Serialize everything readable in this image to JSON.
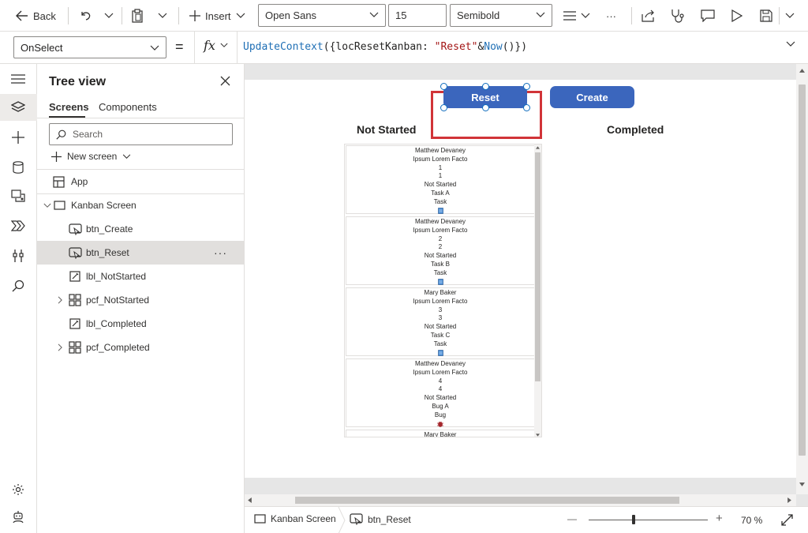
{
  "toolbar": {
    "back_label": "Back",
    "insert_label": "Insert",
    "font_family": "Open Sans",
    "font_size": "15",
    "font_weight": "Semibold",
    "more_label": "···"
  },
  "formula": {
    "property": "OnSelect",
    "equals": "=",
    "fx": "fx",
    "code_fn1": "UpdateContext",
    "code_part1": "({locResetKanban: ",
    "code_str": "\"Reset\"",
    "code_amp": "&",
    "code_fn2": "Now",
    "code_end": "()})"
  },
  "tree": {
    "title": "Tree view",
    "tabs": [
      "Screens",
      "Components"
    ],
    "search_placeholder": "Search",
    "new_screen_label": "New screen",
    "nodes": [
      {
        "label": "App"
      },
      {
        "label": "Kanban Screen"
      },
      {
        "label": "btn_Create"
      },
      {
        "label": "btn_Reset",
        "more": "···"
      },
      {
        "label": "lbl_NotStarted"
      },
      {
        "label": "pcf_NotStarted"
      },
      {
        "label": "lbl_Completed"
      },
      {
        "label": "pcf_Completed"
      }
    ]
  },
  "canvas": {
    "reset_label": "Reset",
    "create_label": "Create",
    "not_started_label": "Not Started",
    "completed_label": "Completed",
    "cards": [
      {
        "lines": [
          "Matthew Devaney",
          "Ipsum Lorem Facto",
          "1",
          "1",
          "Not Started",
          "Task A",
          "Task"
        ],
        "icon": "task-icon"
      },
      {
        "lines": [
          "Matthew Devaney",
          "Ipsum Lorem Facto",
          "2",
          "2",
          "Not Started",
          "Task B",
          "Task"
        ],
        "icon": "task-icon"
      },
      {
        "lines": [
          "Mary Baker",
          "Ipsum Lorem Facto",
          "3",
          "3",
          "Not Started",
          "Task C",
          "Task"
        ],
        "icon": "task-icon"
      },
      {
        "lines": [
          "Matthew Devaney",
          "Ipsum Lorem Facto",
          "4",
          "4",
          "Not Started",
          "Bug A",
          "Bug"
        ],
        "icon": "bug-icon"
      },
      {
        "lines": [
          "Mary Baker"
        ],
        "icon": ""
      }
    ]
  },
  "status": {
    "screen_crumb": "Kanban Screen",
    "control_crumb": "btn_Reset",
    "zoom": "70 %",
    "zoom_minus": "—",
    "zoom_plus": "+"
  },
  "colors": {
    "accent": "#3b66bd",
    "highlight": "#d13438",
    "selection": "#0f6cbd"
  }
}
